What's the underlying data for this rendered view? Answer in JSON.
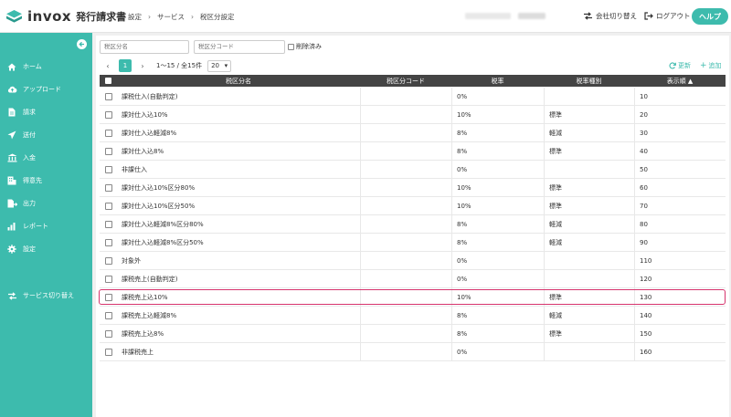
{
  "header": {
    "logo_text": "invox",
    "logo_sub": "発行請求書",
    "breadcrumb": [
      "設定",
      "サービス",
      "税区分設定"
    ],
    "company_switch": "会社切り替え",
    "logout": "ログアウト",
    "help": "ヘルプ"
  },
  "sidebar": {
    "items": [
      {
        "label": "ホーム",
        "icon": "home-icon"
      },
      {
        "label": "アップロード",
        "icon": "cloud-upload-icon"
      },
      {
        "label": "請求",
        "icon": "document-icon"
      },
      {
        "label": "送付",
        "icon": "send-icon"
      },
      {
        "label": "入金",
        "icon": "bank-icon"
      },
      {
        "label": "得意先",
        "icon": "building-icon"
      },
      {
        "label": "出力",
        "icon": "export-icon"
      },
      {
        "label": "レポート",
        "icon": "chart-icon"
      },
      {
        "label": "設定",
        "icon": "gear-icon"
      }
    ],
    "service_switch": "サービス切り替え"
  },
  "filters": {
    "name_placeholder": "税区分名",
    "code_placeholder": "税区分コード",
    "deleted_label": "削除済み"
  },
  "pager": {
    "current": "1",
    "info": "1〜15 / 全15件",
    "page_size": "20"
  },
  "actions": {
    "refresh": "更新",
    "add": "追加"
  },
  "table": {
    "columns": [
      "税区分名",
      "税区分コード",
      "税率",
      "税率種別",
      "表示順 ▲"
    ],
    "rows": [
      {
        "name": "課税仕入(自動判定)",
        "code": "",
        "rate": "0%",
        "kind": "",
        "order": "10"
      },
      {
        "name": "課対仕入込10%",
        "code": "",
        "rate": "10%",
        "kind": "標準",
        "order": "20"
      },
      {
        "name": "課対仕入込軽減8%",
        "code": "",
        "rate": "8%",
        "kind": "軽減",
        "order": "30"
      },
      {
        "name": "課対仕入込8%",
        "code": "",
        "rate": "8%",
        "kind": "標準",
        "order": "40"
      },
      {
        "name": "非課仕入",
        "code": "",
        "rate": "0%",
        "kind": "",
        "order": "50"
      },
      {
        "name": "課対仕入込10%区分80%",
        "code": "",
        "rate": "10%",
        "kind": "標準",
        "order": "60"
      },
      {
        "name": "課対仕入込10%区分50%",
        "code": "",
        "rate": "10%",
        "kind": "標準",
        "order": "70"
      },
      {
        "name": "課対仕入込軽減8%区分80%",
        "code": "",
        "rate": "8%",
        "kind": "軽減",
        "order": "80"
      },
      {
        "name": "課対仕入込軽減8%区分50%",
        "code": "",
        "rate": "8%",
        "kind": "軽減",
        "order": "90"
      },
      {
        "name": "対象外",
        "code": "",
        "rate": "0%",
        "kind": "",
        "order": "110"
      },
      {
        "name": "課税売上(自動判定)",
        "code": "",
        "rate": "0%",
        "kind": "",
        "order": "120"
      },
      {
        "name": "課税売上込10%",
        "code": "",
        "rate": "10%",
        "kind": "標準",
        "order": "130",
        "highlighted": true
      },
      {
        "name": "課税売上込軽減8%",
        "code": "",
        "rate": "8%",
        "kind": "軽減",
        "order": "140"
      },
      {
        "name": "課税売上込8%",
        "code": "",
        "rate": "8%",
        "kind": "標準",
        "order": "150"
      },
      {
        "name": "非課税売上",
        "code": "",
        "rate": "0%",
        "kind": "",
        "order": "160"
      }
    ]
  },
  "colors": {
    "accent": "#3dbbad",
    "header_dark": "#444444",
    "highlight": "#d6336c"
  }
}
